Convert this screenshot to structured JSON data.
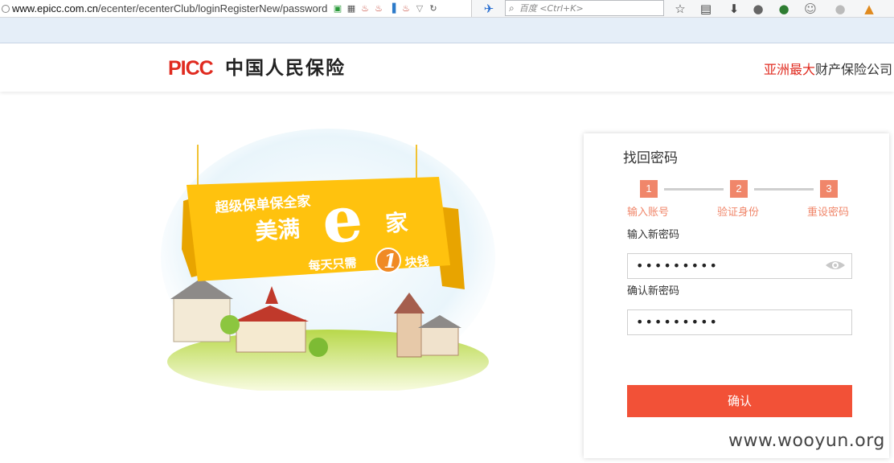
{
  "browser": {
    "url_host": "www.epicc.com.cn",
    "url_path": "/ecenter/ecenterClub/loginRegisterNew/password",
    "search_placeholder": "百度 <Ctrl+K>"
  },
  "header": {
    "logo_latin": "PICC",
    "logo_cn": "中国人民保险",
    "slogan_red": "亚洲最大",
    "slogan_rest": "财产保险公司"
  },
  "banner": {
    "line1": "超级保单保全家",
    "line2": "美满",
    "e_letter": "e",
    "line2_end": "家",
    "line3_a": "每天只需",
    "line3_num": "1",
    "line3_b": "块钱"
  },
  "form": {
    "title": "找回密码",
    "steps": [
      {
        "num": "1",
        "label": "输入账号"
      },
      {
        "num": "2",
        "label": "验证身份"
      },
      {
        "num": "3",
        "label": "重设密码"
      }
    ],
    "new_password_label": "输入新密码",
    "new_password_value": "•••••••••",
    "confirm_password_label": "确认新密码",
    "confirm_password_value": "•••••••••",
    "submit_label": "确认"
  },
  "watermark": "www.wooyun.org",
  "colors": {
    "brand_red": "#e02b20",
    "step_orange": "#f0866a",
    "button_red": "#f25137"
  }
}
